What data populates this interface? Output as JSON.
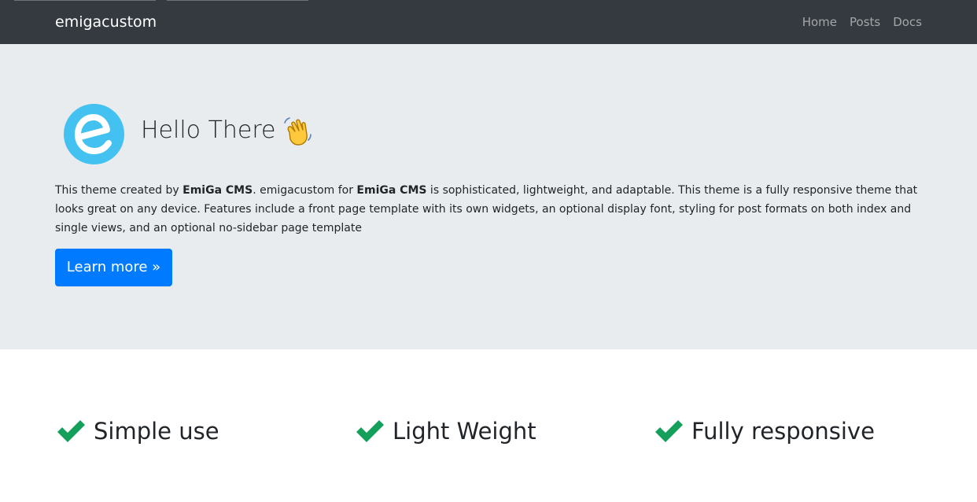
{
  "navbar": {
    "brand": "emigacustom",
    "links": [
      {
        "label": "Home"
      },
      {
        "label": "Posts"
      },
      {
        "label": "Docs"
      }
    ]
  },
  "hero": {
    "title": "Hello There",
    "logo_icon": "emiga-logo-icon",
    "wave_icon": "waving-hand-icon",
    "text_part1": "This theme created by ",
    "bold1": "EmiGa CMS",
    "text_part2": ". emigacustom for ",
    "bold2": "EmiGa CMS",
    "text_part3": " is sophisticated, lightweight, and adaptable. This theme is a fully responsive theme that looks great on any device. Features include a front page template with its own widgets, an optional display font, styling for post formats on both index and single views, and an optional no-sidebar page template",
    "button_label": "Learn more »"
  },
  "features": [
    {
      "label": "Simple use",
      "icon": "check-icon"
    },
    {
      "label": "Light Weight",
      "icon": "check-icon"
    },
    {
      "label": "Fully responsive",
      "icon": "check-icon"
    }
  ],
  "colors": {
    "navbar_bg": "#343a40",
    "jumbotron_bg": "#e9ecef",
    "primary": "#007bff",
    "check_green": "#14a05b",
    "logo_blue": "#43c1f0"
  }
}
